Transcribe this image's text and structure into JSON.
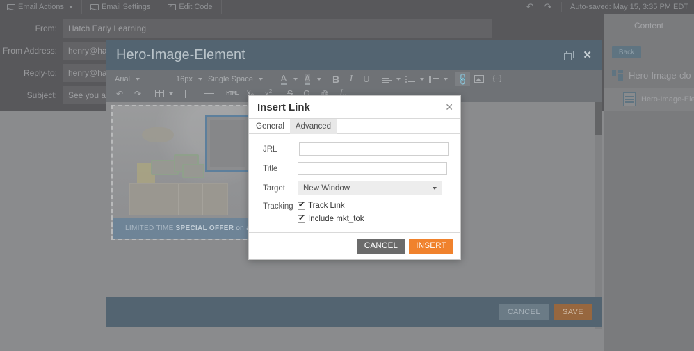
{
  "topbar": {
    "items": [
      {
        "label": "Email Actions",
        "icon": "envelope-icon",
        "caret": true
      },
      {
        "label": "Email Settings",
        "icon": "envelope-icon",
        "caret": false
      },
      {
        "label": "Edit Code",
        "icon": "code-icon",
        "caret": false
      }
    ],
    "undo_icon": "undo-icon",
    "redo_icon": "redo-icon",
    "autosave": "Auto-saved: May 15, 3:35 PM EDT"
  },
  "email_form": {
    "rows": [
      {
        "label": "From:",
        "value": "Hatch Early Learning"
      },
      {
        "label": "From Address:",
        "value": "henry@hatch"
      },
      {
        "label": "Reply-to:",
        "value": "henry@hatch"
      },
      {
        "label": "Subject:",
        "value": "See you at L"
      }
    ]
  },
  "sidebar": {
    "tab_label": "Content",
    "back_label": "Back",
    "tree": [
      {
        "label": "Hero-Image-clo",
        "icon": "module-icon"
      },
      {
        "label": "Hero-Image-Ele",
        "icon": "document-icon"
      }
    ]
  },
  "editor": {
    "title": "Hero-Image-Element",
    "restore_icon": "restore-window-icon",
    "close_icon": "close-icon",
    "toolbar": {
      "font_family": "Arial",
      "font_size": "16px",
      "line_spacing": "Single Space",
      "buttons_row1": [
        {
          "name": "text-color-button",
          "glyph": "A"
        },
        {
          "name": "highlight-color-button",
          "glyph": "A"
        },
        {
          "name": "bold-button",
          "glyph": "B"
        },
        {
          "name": "italic-button",
          "glyph": "I"
        },
        {
          "name": "underline-button",
          "glyph": "U"
        },
        {
          "name": "align-button",
          "glyph": "align"
        },
        {
          "name": "bullet-list-button",
          "glyph": "list"
        },
        {
          "name": "indent-button",
          "glyph": "indent"
        },
        {
          "name": "insert-link-button",
          "glyph": "link"
        },
        {
          "name": "insert-image-button",
          "glyph": "image"
        },
        {
          "name": "insert-token-button",
          "glyph": "{..}"
        }
      ],
      "buttons_row2": [
        {
          "name": "undo-button",
          "glyph": "↰"
        },
        {
          "name": "redo-button",
          "glyph": "↱"
        },
        {
          "name": "insert-table-button",
          "glyph": "table"
        },
        {
          "name": "bookmark-button",
          "glyph": "bookmark"
        },
        {
          "name": "horizontal-rule-button",
          "glyph": "—"
        },
        {
          "name": "html-snippet-button",
          "glyph": "HTML"
        },
        {
          "name": "subscript-button",
          "glyph": "x2"
        },
        {
          "name": "superscript-button",
          "glyph": "x2"
        },
        {
          "name": "strikethrough-button",
          "glyph": "S"
        },
        {
          "name": "special-character-button",
          "glyph": "Ω"
        },
        {
          "name": "find-replace-button",
          "glyph": "binoculars"
        },
        {
          "name": "clear-formatting-button",
          "glyph": "Ix"
        }
      ]
    },
    "preview": {
      "banner_pre": "LIMITED TIME",
      "banner_strong": "SPECIAL OFFER",
      "banner_post": "on a"
    },
    "footer": {
      "cancel_label": "CANCEL",
      "save_label": "SAVE"
    }
  },
  "link_dialog": {
    "title": "Insert Link",
    "close_icon": "close-icon",
    "tabs": [
      {
        "label": "General",
        "state": "normal"
      },
      {
        "label": "Advanced",
        "state": "hover"
      }
    ],
    "fields": {
      "url_label": "JRL",
      "url_value": "",
      "url_placeholder": "",
      "title_label": "Title",
      "title_value": "",
      "title_placeholder": "",
      "target_label": "Target",
      "target_value": "New Window",
      "tracking_label": "Tracking",
      "track_link_label": "Track Link",
      "track_link_checked": true,
      "include_mkt_tok_label": "Include mkt_tok",
      "include_mkt_tok_checked": true
    },
    "cancel_label": "CANCEL",
    "insert_label": "INSERT",
    "colors": {
      "insert_button": "#f0822d",
      "cancel_button": "#6b6b6b"
    }
  }
}
